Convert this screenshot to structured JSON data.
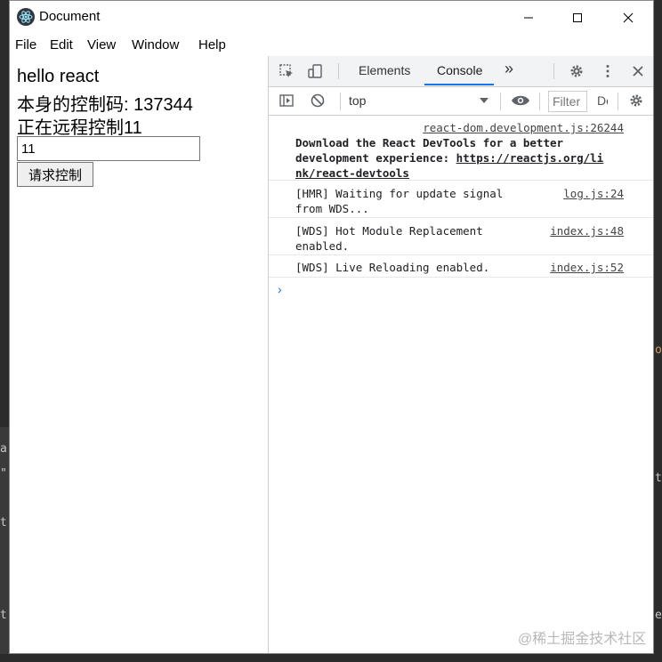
{
  "window": {
    "title": "Document",
    "controls": {
      "minimize": "–",
      "maximize": "☐",
      "close": "✕"
    }
  },
  "menu": [
    "File",
    "Edit",
    "View",
    "Window",
    "Help"
  ],
  "app": {
    "heading": "hello react",
    "own_code": "本身的控制码: 137344",
    "remote_status": "正在远程控制11",
    "code_input_value": "11",
    "request_button": "请求控制"
  },
  "devtools": {
    "tabs": [
      "Elements",
      "Console"
    ],
    "active_tab": "Console",
    "more_tabs": "»",
    "context": "top",
    "filter_placeholder": "Filter",
    "levels_label": "De",
    "messages": [
      {
        "source": "react-dom.development.js:26244",
        "lines": [
          "Download the React DevTools for a better",
          "development experience: "
        ],
        "link_parts": [
          "https://reactjs.org/li",
          "nk/react-devtools"
        ]
      },
      {
        "source": "log.js:24",
        "lines": [
          "[HMR] Waiting for update signal",
          "from WDS..."
        ]
      },
      {
        "source": "index.js:48",
        "lines": [
          "[WDS] Hot Module Replacement",
          "enabled."
        ]
      },
      {
        "source": "index.js:52",
        "lines": [
          "[WDS] Live Reloading enabled."
        ]
      }
    ],
    "prompt_symbol": "›"
  },
  "watermark": "@稀土掘金技术社区",
  "colors": {
    "accent": "#1a73e8",
    "toolbar_bg": "#f1f3f4",
    "desktop_bg": "#2b2b2b"
  }
}
